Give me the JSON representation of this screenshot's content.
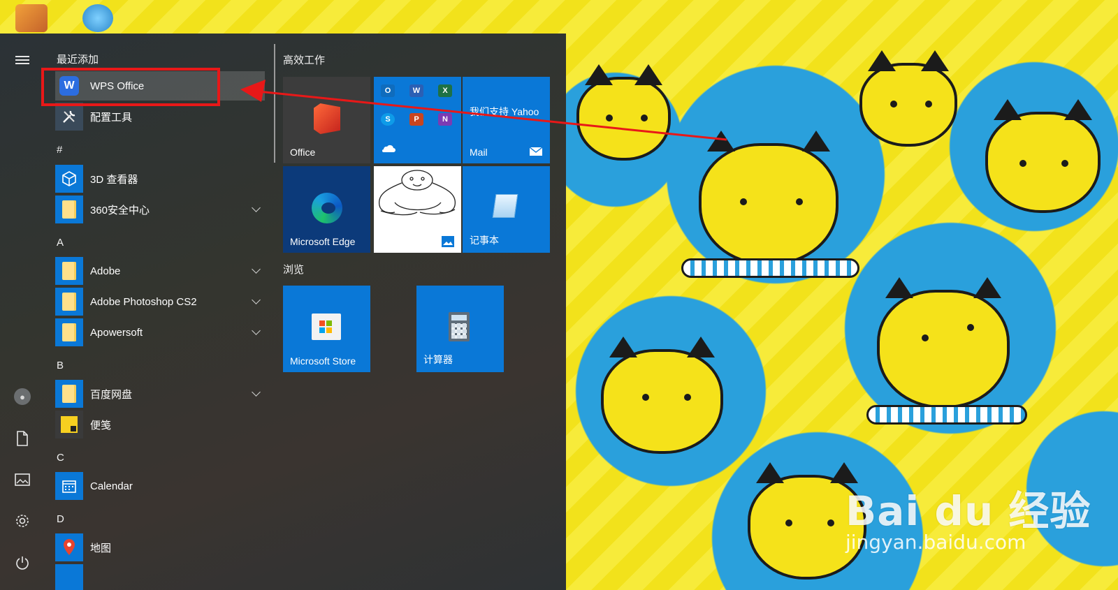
{
  "desktop": {
    "watermark_brand": "Bai du 经验",
    "watermark_url": "jingyan.baidu.com"
  },
  "rail": {
    "menu_icon": "hamburger-menu-icon",
    "user_icon": "user-account-icon",
    "documents_icon": "document-icon",
    "pictures_icon": "picture-icon",
    "settings_icon": "gear-icon",
    "power_icon": "power-icon"
  },
  "applist": {
    "recent_header": "最近添加",
    "groups": [
      {
        "letter": "#"
      },
      {
        "letter": "A"
      },
      {
        "letter": "B"
      },
      {
        "letter": "C"
      },
      {
        "letter": "D"
      }
    ],
    "items": [
      {
        "label": "WPS Office",
        "selected": true
      },
      {
        "label": "配置工具"
      },
      {
        "label": "3D 查看器"
      },
      {
        "label": "360安全中心",
        "expandable": true
      },
      {
        "label": "Adobe",
        "expandable": true
      },
      {
        "label": "Adobe Photoshop CS2",
        "expandable": true
      },
      {
        "label": "Apowersoft",
        "expandable": true
      },
      {
        "label": "百度网盘",
        "expandable": true
      },
      {
        "label": "便笺"
      },
      {
        "label": "Calendar"
      },
      {
        "label": "地图"
      }
    ]
  },
  "tiles": {
    "group1_title": "高效工作",
    "group2_title": "浏览",
    "office": "Office",
    "mail_promo": "我们支持 Yahoo",
    "mail": "Mail",
    "edge": "Microsoft Edge",
    "notepad": "记事本",
    "store": "Microsoft Store",
    "calculator": "计算器"
  },
  "colors": {
    "annotation_red": "#e81818",
    "tile_blue": "#0a78d7",
    "wps_blue": "#2c6de0"
  }
}
